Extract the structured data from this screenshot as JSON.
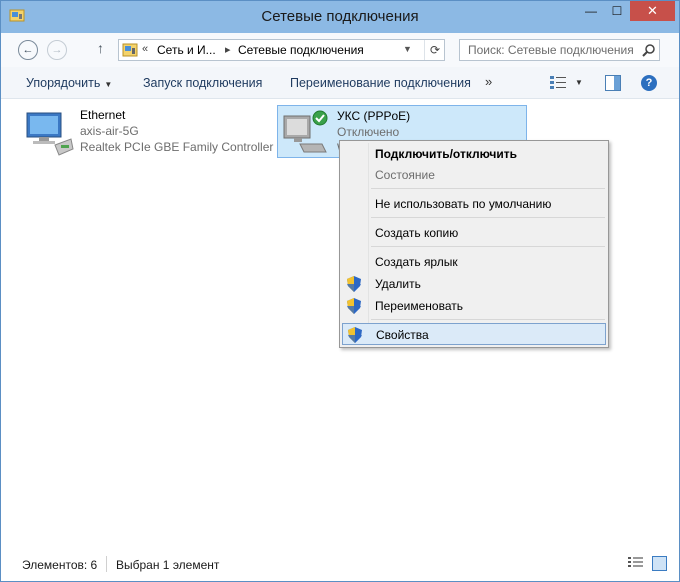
{
  "window": {
    "title": "Сетевые подключения",
    "controls": {
      "minimize": "—",
      "maximize": "☐",
      "close": "✕"
    }
  },
  "navigation": {
    "breadcrumb_prefix": "«",
    "breadcrumb": [
      "Сеть и И...",
      "Сетевые подключения"
    ],
    "search_placeholder": "Поиск: Сетевые подключения"
  },
  "toolbar": {
    "organize": "Упорядочить",
    "start_connection": "Запуск подключения",
    "rename_connection": "Переименование подключения",
    "more": "»"
  },
  "connections": [
    {
      "name": "Ethernet",
      "network": "axis-air-5G",
      "device": "Realtek PCIe GBE Family Controller",
      "selected": false
    },
    {
      "name": "УКС (PPPoE)",
      "status": "Отключено",
      "device_partial": "W",
      "selected": true
    }
  ],
  "context_menu": {
    "items": [
      {
        "label": "Подключить/отключить",
        "bold": true
      },
      {
        "label": "Состояние",
        "disabled": true
      },
      {
        "label": "Не использовать по умолчанию"
      },
      {
        "label": "Создать копию"
      },
      {
        "label": "Создать ярлык"
      },
      {
        "label": "Удалить",
        "shield": true
      },
      {
        "label": "Переименовать",
        "shield": true
      },
      {
        "label": "Свойства",
        "shield": true,
        "highlighted": true
      }
    ]
  },
  "status_bar": {
    "items_count": "Элементов: 6",
    "selected": "Выбран 1 элемент"
  },
  "colors": {
    "titlebar": "#8cb9e4",
    "selection": "#cde8fa",
    "menu_highlight": "#dbeaf8"
  }
}
